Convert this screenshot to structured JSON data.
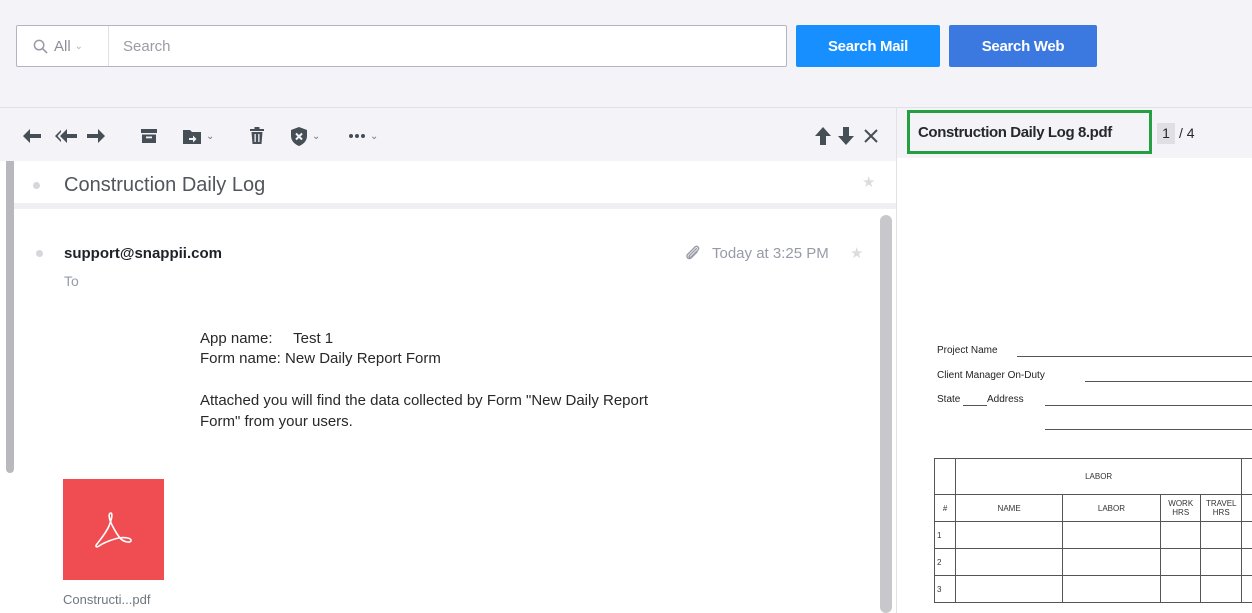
{
  "search": {
    "scope_label": "All",
    "placeholder": "Search",
    "value": "",
    "search_mail_label": "Search Mail",
    "search_web_label": "Search Web"
  },
  "toolbar": {
    "icons": [
      "reply-icon",
      "reply-all-icon",
      "forward-icon",
      "archive-icon",
      "move-icon",
      "delete-icon",
      "spam-icon",
      "more-icon",
      "previous-message-icon",
      "next-message-icon",
      "close-icon"
    ]
  },
  "message": {
    "subject": "Construction Daily Log",
    "sender": "support@snappii.com",
    "to_label": "To",
    "time": "Today at 3:25 PM",
    "body": {
      "app_name_line": "App name:     Test 1",
      "form_name_line": "Form name: New Daily Report Form",
      "attached_line_1": "Attached you will find the data collected by Form \"New Daily Report",
      "attached_line_2": "Form\" from your users."
    },
    "attachment": {
      "name": "Constructi...pdf"
    }
  },
  "pdf_viewer": {
    "file_name": "Construction Daily Log 8.pdf",
    "current_page": "1",
    "page_total": "/ 4",
    "document": {
      "project_name_label": "Project Name",
      "client_manager_label": "Client Manager On-Duty",
      "state_label": "State",
      "address_label": "Address",
      "labor_heading": "LABOR",
      "columns": [
        "#",
        "NAME",
        "LABOR",
        "WORK HRS",
        "TRAVEL HRS"
      ],
      "rows": [
        "1",
        "2",
        "3"
      ]
    }
  },
  "colors": {
    "search_mail_button": "#188fff",
    "search_web_button": "#3b78e0",
    "pdf_title_highlight": "#24a043",
    "attachment_thumb": "#ef4d51"
  }
}
